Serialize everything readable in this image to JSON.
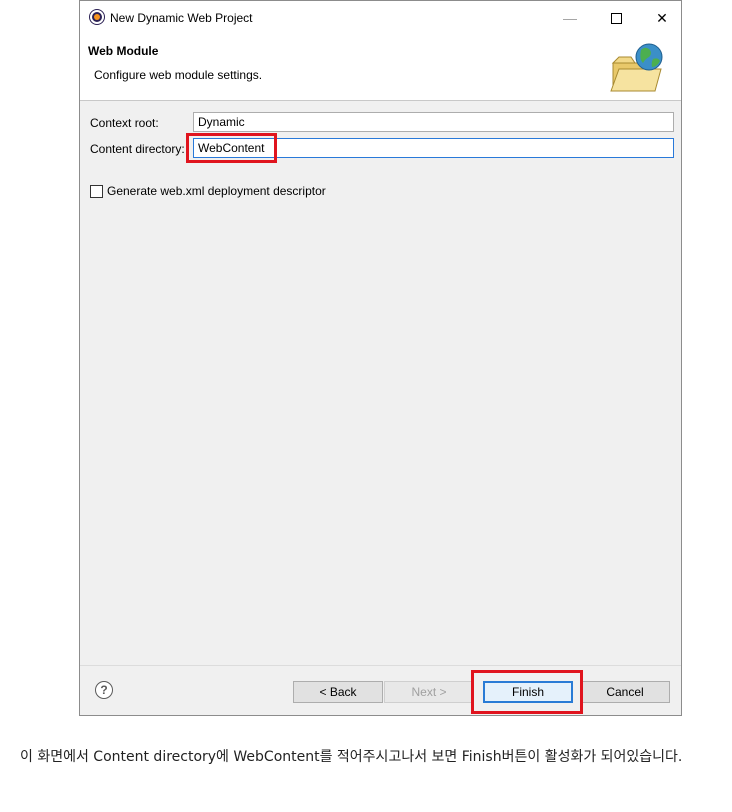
{
  "window": {
    "title": "New Dynamic Web Project",
    "minimize_glyph": "—",
    "maximize_glyph": "☐",
    "close_glyph": "✕"
  },
  "header": {
    "title": "Web Module",
    "description": "Configure web module settings.",
    "icon": "folder-globe-icon"
  },
  "form": {
    "context_root_label": "Context root:",
    "context_root_value": "Dynamic",
    "content_directory_label": "Content directory:",
    "content_directory_value": "WebContent",
    "generate_checkbox_label": "Generate web.xml deployment descriptor",
    "generate_checked": false
  },
  "footer": {
    "help_glyph": "?",
    "back_label": "< Back",
    "next_label": "Next >",
    "finish_label": "Finish",
    "cancel_label": "Cancel"
  },
  "caption": "이 화면에서 Content directory에 WebContent를 적어주시고나서 보면 Finish버튼이 활성화가 되어있습니다.",
  "colors": {
    "highlight_red": "#e0141e",
    "focus_blue": "#2979d9"
  }
}
